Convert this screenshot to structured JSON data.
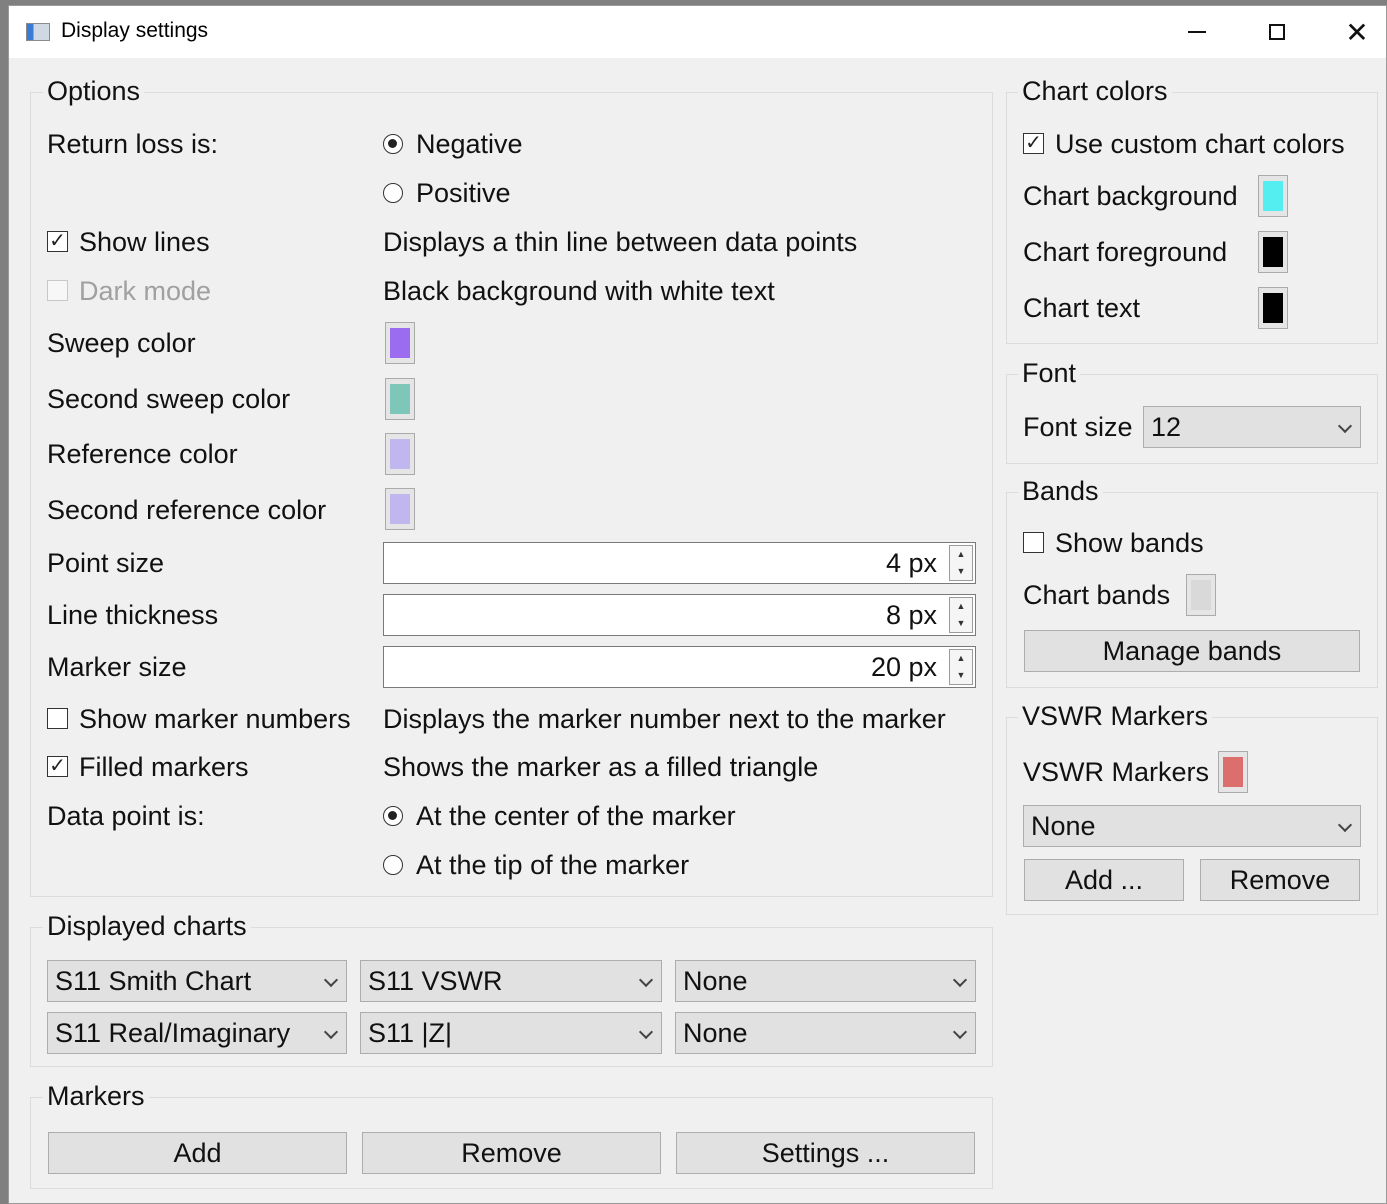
{
  "window": {
    "title": "Display settings"
  },
  "options": {
    "title": "Options",
    "return_loss_label": "Return loss is:",
    "return_loss_options": [
      "Negative",
      "Positive"
    ],
    "return_loss_selected": "Negative",
    "show_lines": {
      "label": "Show lines",
      "checked": true,
      "description": "Displays a thin line between data points"
    },
    "dark_mode": {
      "label": "Dark mode",
      "checked": false,
      "enabled": false,
      "description": "Black background with white text"
    },
    "colors": [
      {
        "label": "Sweep color",
        "color": "#9b6bf0"
      },
      {
        "label": "Second sweep color",
        "color": "#7dc6b8"
      },
      {
        "label": "Reference color",
        "color": "#c1b6ee"
      },
      {
        "label": "Second reference color",
        "color": "#c1b6ee"
      }
    ],
    "point_size": {
      "label": "Point size",
      "value": "4 px"
    },
    "line_thickness": {
      "label": "Line thickness",
      "value": "8 px"
    },
    "marker_size": {
      "label": "Marker size",
      "value": "20 px"
    },
    "show_marker_numbers": {
      "label": "Show marker numbers",
      "checked": false,
      "description": "Displays the marker number next to the marker"
    },
    "filled_markers": {
      "label": "Filled markers",
      "checked": true,
      "description": "Shows the marker as a filled triangle"
    },
    "data_point_label": "Data point is:",
    "data_point_options": [
      "At the center of the marker",
      "At the tip of the marker"
    ],
    "data_point_selected": "At the center of the marker"
  },
  "displayed_charts": {
    "title": "Displayed charts",
    "row1": [
      "S11 Smith Chart",
      "S11 VSWR",
      "None"
    ],
    "row2": [
      "S11 Real/Imaginary",
      "S11 |Z|",
      "None"
    ]
  },
  "markers": {
    "title": "Markers",
    "add": "Add",
    "remove": "Remove",
    "settings": "Settings ..."
  },
  "chart_colors": {
    "title": "Chart colors",
    "use_custom": {
      "label": "Use custom chart colors",
      "checked": true
    },
    "background": {
      "label": "Chart background",
      "color": "#55eef0"
    },
    "foreground": {
      "label": "Chart foreground",
      "color": "#000000"
    },
    "text": {
      "label": "Chart text",
      "color": "#000000"
    }
  },
  "font": {
    "title": "Font",
    "size_label": "Font size",
    "size_value": "12"
  },
  "bands": {
    "title": "Bands",
    "show_bands": {
      "label": "Show bands",
      "checked": false
    },
    "chart_bands_label": "Chart bands",
    "chart_bands_color": "#d9d9d9",
    "manage": "Manage bands"
  },
  "vswr": {
    "title": "VSWR Markers",
    "label": "VSWR Markers",
    "color": "#dc6e6e",
    "select_value": "None",
    "add": "Add ...",
    "remove": "Remove"
  }
}
